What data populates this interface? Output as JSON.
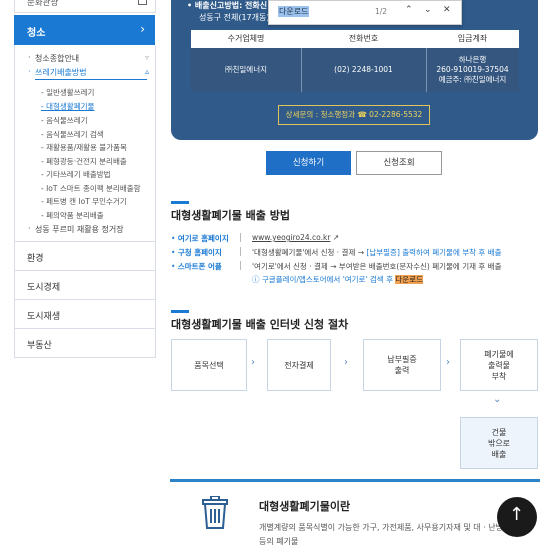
{
  "sidebar": {
    "top_item": "문화관광",
    "active_label": "청소",
    "sub_items": [
      {
        "label": "청소종합안내",
        "selected": false
      },
      {
        "label": "쓰레기배출방법",
        "selected": true
      }
    ],
    "sub_sub_items": [
      {
        "label": "일반생활쓰레기",
        "selected": false
      },
      {
        "label": "대형생활폐기물",
        "selected": true
      },
      {
        "label": "음식물쓰레기",
        "selected": false
      },
      {
        "label": "음식물쓰레기 검색",
        "selected": false
      },
      {
        "label": "재활용품/재활용 불가품목",
        "selected": false
      },
      {
        "label": "폐형광등·건전지 분리배출",
        "selected": false
      },
      {
        "label": "기타쓰레기 배출방법",
        "selected": false
      },
      {
        "label": "IoT 스마트 종이팩 분리배출함",
        "selected": false
      },
      {
        "label": "페트병 캔 IoT 무인수거기",
        "selected": false
      },
      {
        "label": "폐의약품 분리배출",
        "selected": false
      }
    ],
    "last_sub": "성동 푸르미 재활용 정거장",
    "menu": [
      "환경",
      "도시경제",
      "도시재생",
      "부동산"
    ]
  },
  "panel": {
    "line1": "배출신고방법: 전화신",
    "line2": "성동구 전체(17개동)",
    "table_headers": [
      "수거업체명",
      "전화번호",
      "입금계좌"
    ],
    "company": "㈜친일에너지",
    "phone": "(02) 2248-1001",
    "account_line1": "하나은행",
    "account_line2": "260-910019-37504",
    "account_line3": "예금주: ㈜친일에너지",
    "inquiry": "상세문의 : 청소행정과  ☎ 02-2286-5532"
  },
  "find_bar": {
    "query": "다운로드",
    "count": "1/2"
  },
  "buttons": {
    "apply": "신청하기",
    "check": "신청조회"
  },
  "section1": {
    "title": "대형생활폐기물 배출 방법",
    "rows": [
      {
        "label": "여기로 홈페이지",
        "value": "www.yeogiro24.co.kr"
      },
      {
        "label": "구청 홈페이지",
        "value_a": "'대형생활폐기물'에서 신청 · 결제 → ",
        "value_b": "[납부필증] 출력하여 폐기물에 부착 후 배출"
      },
      {
        "label": "스마트폰 어플",
        "value": "'여기로'에서 신청 · 결제 → 부여받은 배출번호(문자수신) 폐기물에 기재 후 배출"
      }
    ],
    "note_a": "구글플레이/앱스토어에서 '여기로' 검색 후 ",
    "note_b": "다운로드"
  },
  "section2": {
    "title": "대형생활폐기물 배출 인터넷 신청 절차",
    "steps": [
      "품목선택",
      "전자결제",
      "납부필증\n출력",
      "폐기물에\n출력물\n부착",
      "건물\n밖으로\n배출"
    ]
  },
  "card": {
    "title": "대형생활폐기물이란",
    "desc_line1": "개별계량의 품목식별이 가능한 가구, 가전제품, 사무용기자재 및 대 · 난방기",
    "desc_line2": "등의 폐기물"
  },
  "colors": {
    "primary": "#1979d3",
    "panel": "#2f5a8a",
    "highlight": "#f0a050"
  }
}
